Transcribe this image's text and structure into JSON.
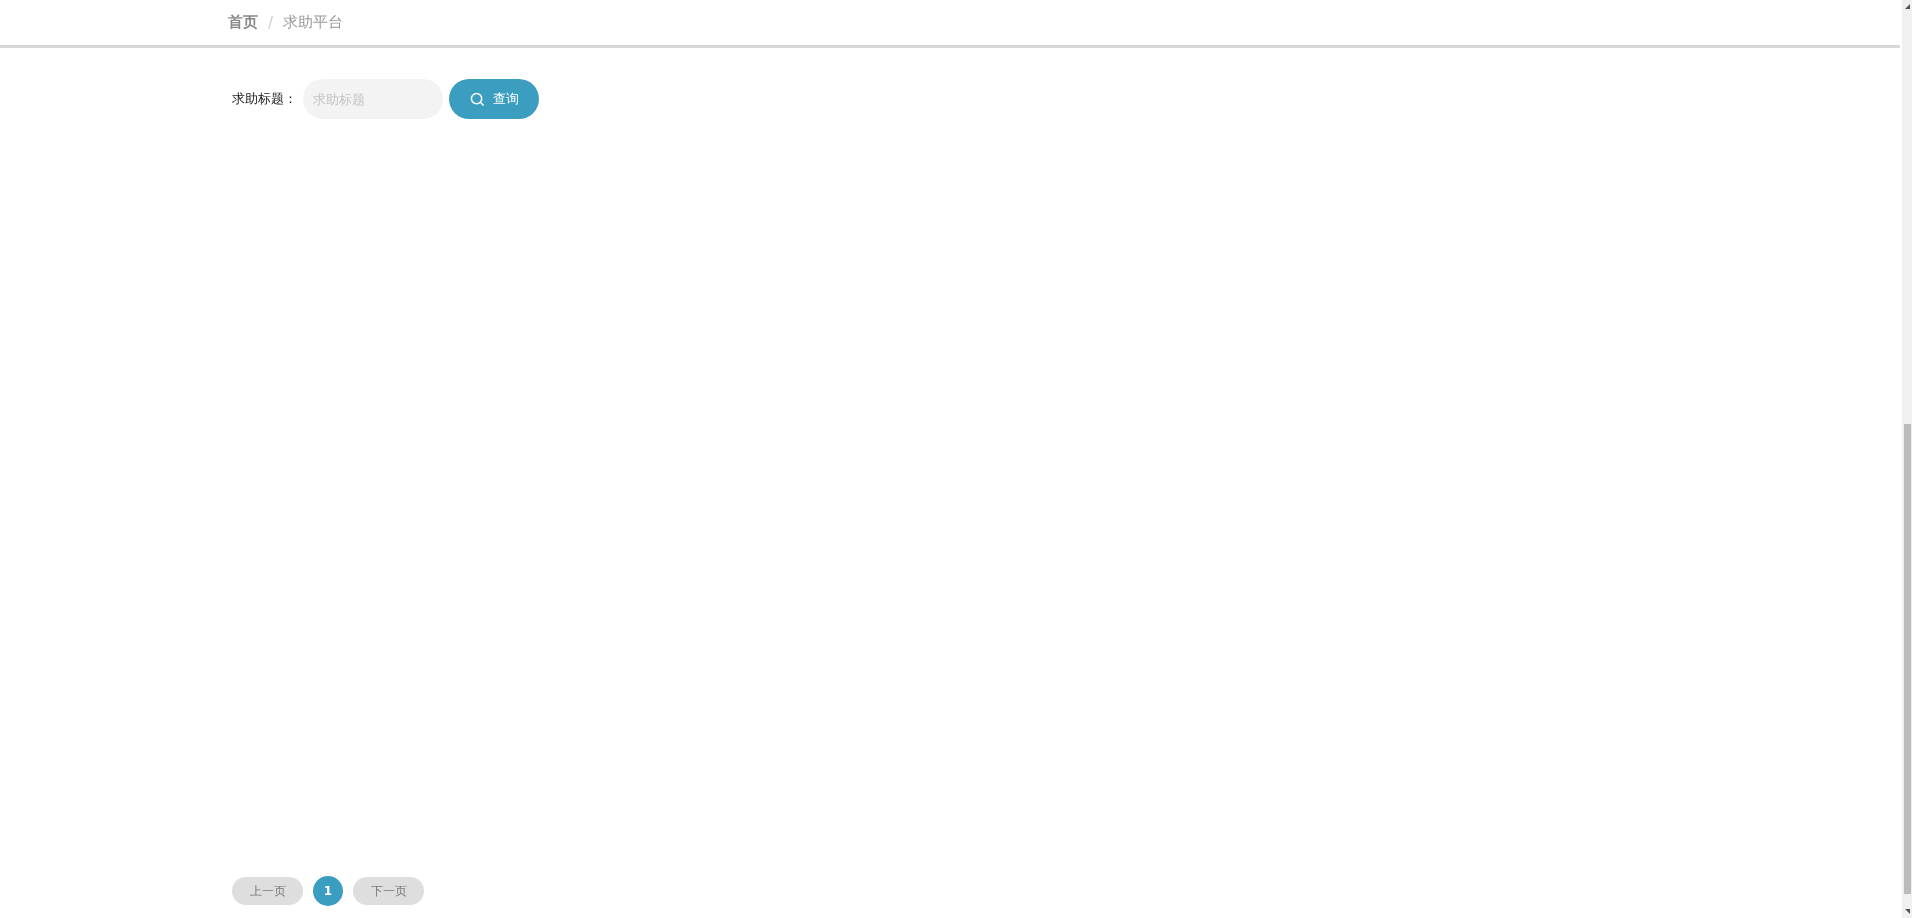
{
  "breadcrumb": [
    {
      "label": "首页",
      "current": false
    },
    {
      "label": "求助平台",
      "current": true
    }
  ],
  "breadcrumb_separator": "/",
  "search": {
    "label": "求助标题：",
    "placeholder": "求助标题",
    "button": "查询"
  },
  "pagination": {
    "prev": "上一页",
    "pages": [
      {
        "label": "1",
        "selected": true
      }
    ],
    "next": "下一页"
  }
}
